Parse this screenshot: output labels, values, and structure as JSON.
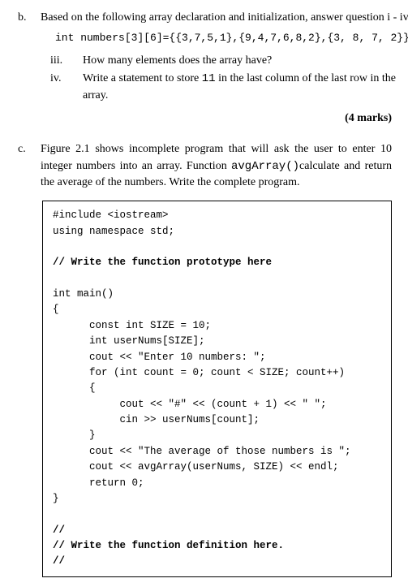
{
  "b": {
    "label": "b.",
    "lead": "Based on the following array declaration and initialization, answer question  i - iv.",
    "decl": "int numbers[3][6]={{3,7,5,1},{9,4,7,6,8,2},{3, 8, 7, 2}};",
    "iii": {
      "label": "iii.",
      "text": "How many elements does the array have?"
    },
    "iv": {
      "label": "iv.",
      "text_a": "Write a statement to store ",
      "code": "11",
      "text_b": " in the last column of the last row in the array."
    },
    "marks": "(4 marks)"
  },
  "c": {
    "label": "c.",
    "para_a": "Figure 2.1 shows incomplete program that will ask the user to enter 10 integer numbers into an array. Function ",
    "fn": "avgArray()",
    "para_b": "calculate and return the average of the numbers. Write the complete program.",
    "code": {
      "l01": "#include <iostream>",
      "l02": "using namespace std;",
      "l03": "// Write the function prototype here",
      "l04": "int main()",
      "l05": "{",
      "l06": "      const int SIZE = 10;",
      "l07": "      int userNums[SIZE];",
      "l08": "      cout << \"Enter 10 numbers: \";",
      "l09": "      for (int count = 0; count < SIZE; count++)",
      "l10": "      {",
      "l11": "           cout << \"#\" << (count + 1) << \" \";",
      "l12": "           cin >> userNums[count];",
      "l13": "      }",
      "l14": "      cout << \"The average of those numbers is \";",
      "l15": "      cout << avgArray(userNums, SIZE) << endl;",
      "l16": "      return 0;",
      "l17": "}",
      "l18": "//",
      "l19": "// Write the function definition here.",
      "l20": "//"
    }
  }
}
